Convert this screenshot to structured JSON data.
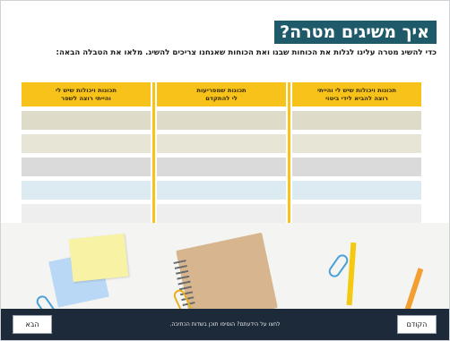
{
  "header": {
    "title": "איך משיגים מטרה?",
    "subtitle": "כדי להשיג מטרה עלינו לגלות את הכוחות שבנו ואת הכוחות שאנחנו צריכים להשיג. מלאו את הטבלה הבאה:"
  },
  "table": {
    "columns": [
      {
        "header_line1": "תכונות ויכולות שיש לי והייתי",
        "header_line2": "רוצה להביא לידי ביטוי"
      },
      {
        "header_line1": "תכונות שמפריעות",
        "header_line2": "לי להתקדם"
      },
      {
        "header_line1": "תכונות ויכולות שיש לי",
        "header_line2": "והייתי רוצה לשפר"
      }
    ],
    "row_colors": [
      "#dedbc9",
      "#e6e5d6",
      "#dadada",
      "#dceaf2",
      "#eeeeee"
    ]
  },
  "footer": {
    "next_label": "הבא",
    "prev_label": "הקודם",
    "message": "לחצו על הידעתם? הוסיפו תוכן בשדות הכתיבה."
  }
}
